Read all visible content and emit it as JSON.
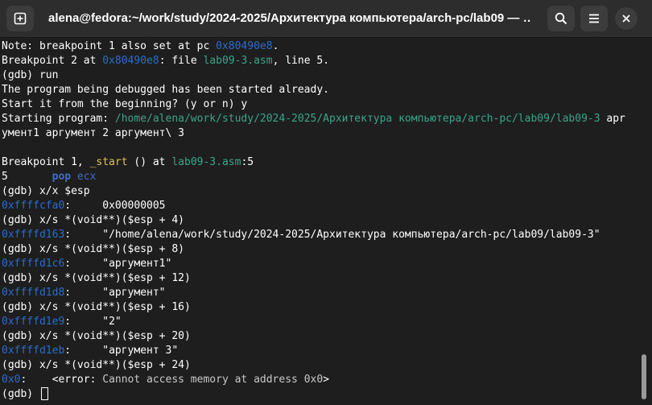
{
  "window": {
    "title": "alena@fedora:~/work/study/2024-2025/Архитектура компьютера/arch-pc/lab09 — …"
  },
  "icons": {
    "new_tab": "new-tab-icon",
    "search": "search-icon",
    "menu": "hamburger-menu-icon",
    "close": "close-icon"
  },
  "colors": {
    "background": "#1e1e1e",
    "titlebar": "#2d2d2d",
    "address": "#2a6ccf",
    "path": "#3aa58a",
    "function": "#d9c45b"
  },
  "terminal": {
    "lines": {
      "l1": {
        "a": "Note: breakpoint 1 also set at pc ",
        "b": "0x80490e8",
        "c": "."
      },
      "l2": {
        "a": "Breakpoint 2 at ",
        "b": "0x80490e8",
        "c": ": file ",
        "d": "lab09-3.asm",
        "e": ", line 5."
      },
      "l3": "(gdb) run",
      "l4": "The program being debugged has been started already.",
      "l5": "Start it from the beginning? (y or n) y",
      "l6": {
        "a": "Starting program: ",
        "b": "/home/alena/work/study/2024-2025/Архитектура компьютера/arch-pc/lab09/lab09-3",
        "c": " apr"
      },
      "l7": "умент1 аргумент 2 аргумент\\ 3",
      "l8": "",
      "l9": {
        "a": "Breakpoint 1, ",
        "b": "_start",
        "c": " () at ",
        "d": "lab09-3.asm",
        "e": ":5"
      },
      "l10": {
        "a": "5       ",
        "b": "pop",
        "c": " ecx"
      },
      "l11": "(gdb) x/x $esp",
      "l12": {
        "a": "0xffffcfa0",
        "b": ":     0x00000005"
      },
      "l13": "(gdb) x/s *(void**)($esp + 4)",
      "l14": {
        "a": "0xffffd163",
        "b": ":     \"/home/alena/work/study/2024-2025/Архитектура компьютера/arch-pc/lab09/lab09-3\""
      },
      "l15": "(gdb) x/s *(void**)($esp + 8)",
      "l16": {
        "a": "0xffffd1c6",
        "b": ":     \"аргумент1\""
      },
      "l17": "(gdb) x/s *(void**)($esp + 12)",
      "l18": {
        "a": "0xffffd1d8",
        "b": ":     \"аргумент\""
      },
      "l19": "(gdb) x/s *(void**)($esp + 16)",
      "l20": {
        "a": "0xffffd1e9",
        "b": ":     \"2\""
      },
      "l21": "(gdb) x/s *(void**)($esp + 20)",
      "l22": {
        "a": "0xffffd1eb",
        "b": ":     \"аргумент 3\""
      },
      "l23": "(gdb) x/s *(void**)($esp + 24)",
      "l24": {
        "a": "0x0",
        "b": ":    <error: ",
        "c": "Cannot access memory at address 0x0",
        "d": ">"
      },
      "l25": "(gdb) "
    }
  }
}
